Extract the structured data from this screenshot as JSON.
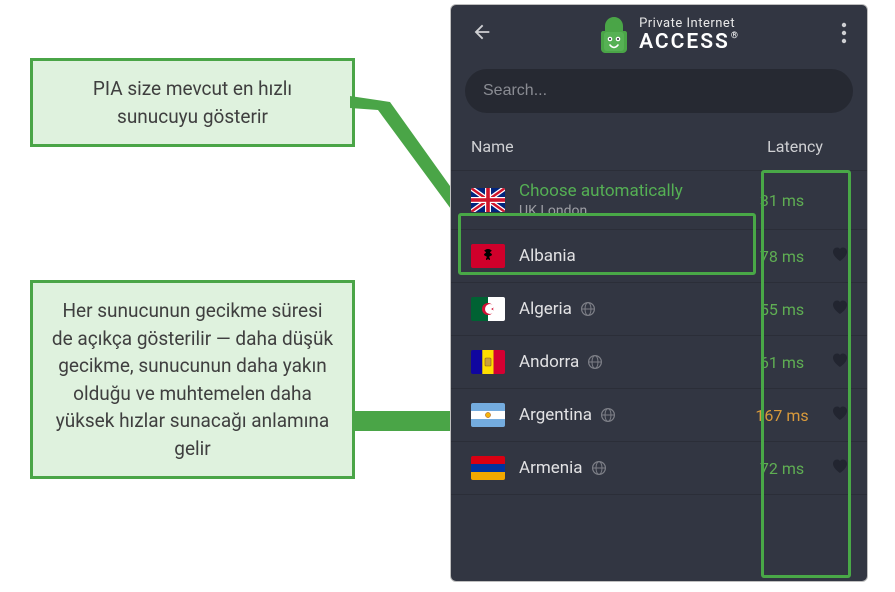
{
  "callouts": {
    "c1": "PIA size mevcut en hızlı sunucuyu gösterir",
    "c2": "Her sunucunun gecikme süresi de açıkça gösterilir — daha düşük gecikme, sunucunun daha yakın olduğu ve muhtemelen daha yüksek hızlar sunacağı anlamına gelir"
  },
  "brand": {
    "line1": "Private Internet",
    "line2": "ACCESS"
  },
  "search": {
    "placeholder": "Search..."
  },
  "columns": {
    "name": "Name",
    "latency": "Latency"
  },
  "auto": {
    "title": "Choose automatically",
    "sub": "UK London",
    "latency": "31 ms"
  },
  "servers": [
    {
      "name": "Albania",
      "latency": "78 ms",
      "lat_class": "lat-green",
      "flag": "al",
      "globe": false
    },
    {
      "name": "Algeria",
      "latency": "55 ms",
      "lat_class": "lat-green",
      "flag": "dz",
      "globe": true
    },
    {
      "name": "Andorra",
      "latency": "61 ms",
      "lat_class": "lat-green",
      "flag": "ad",
      "globe": true
    },
    {
      "name": "Argentina",
      "latency": "167 ms",
      "lat_class": "lat-orange",
      "flag": "ar",
      "globe": true
    },
    {
      "name": "Armenia",
      "latency": "72 ms",
      "lat_class": "lat-green",
      "flag": "am",
      "globe": true
    }
  ]
}
